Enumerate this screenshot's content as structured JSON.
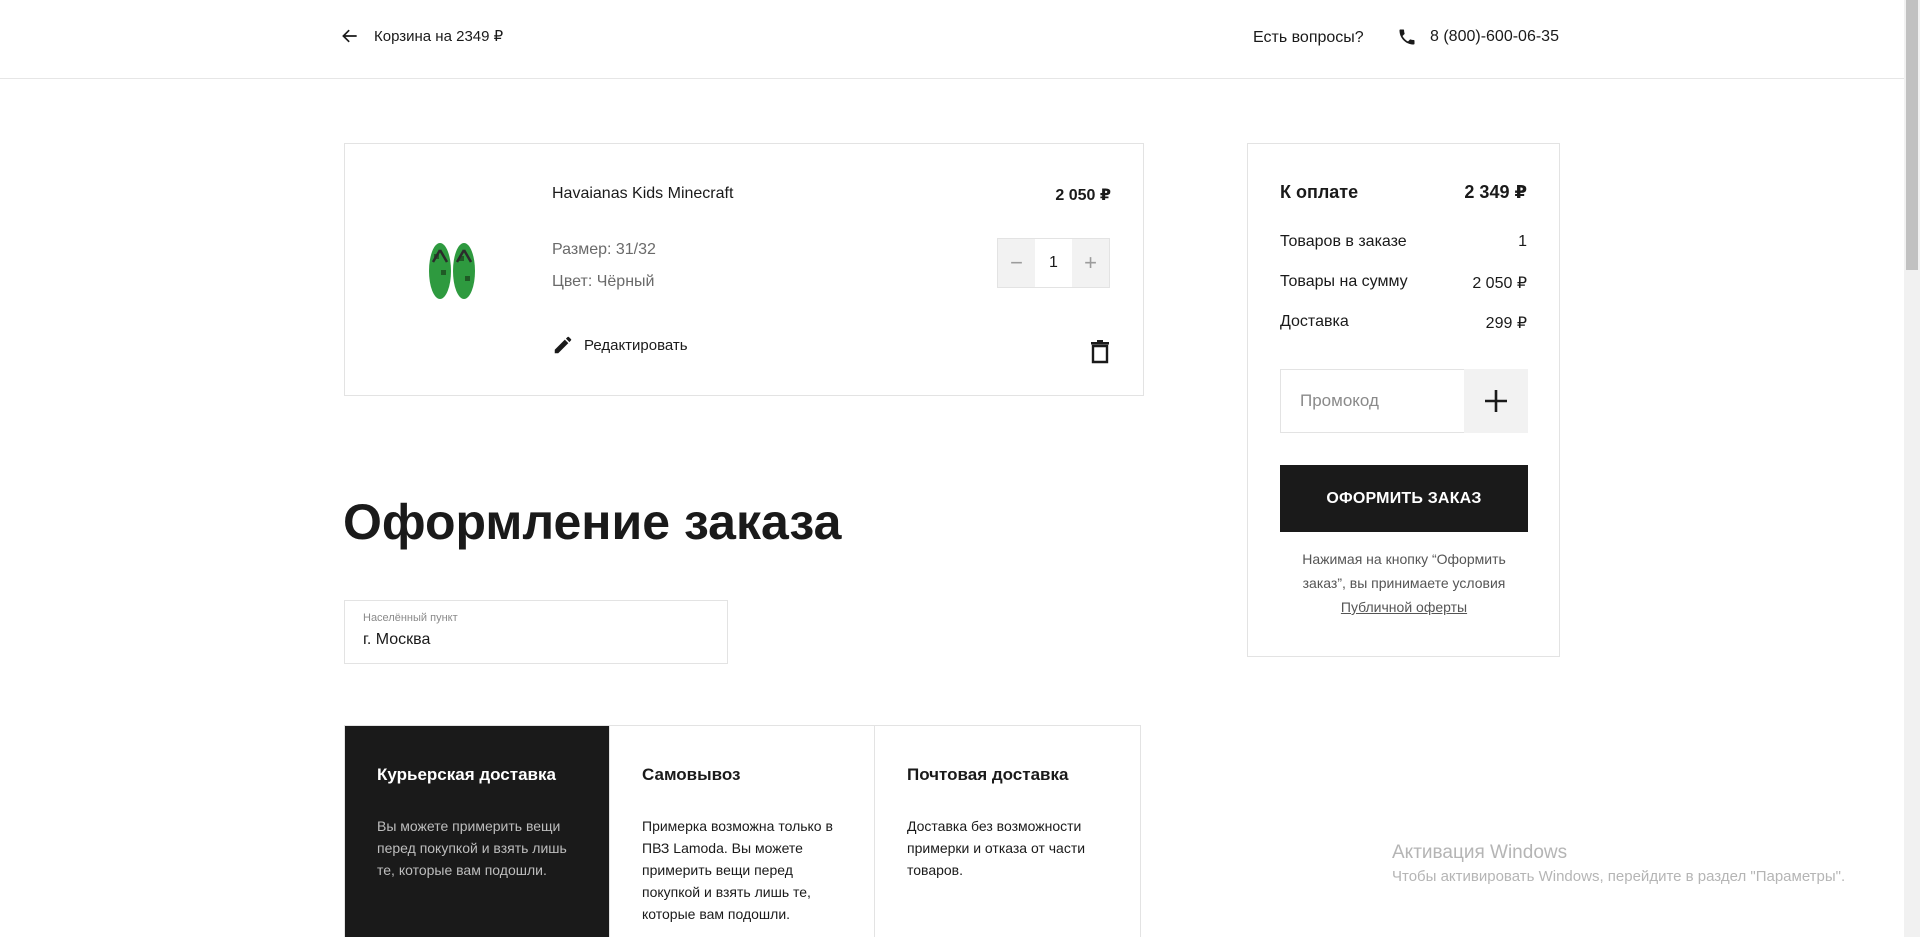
{
  "header": {
    "back_label": "Корзина на 2349 ₽",
    "help_label": "Есть вопросы?",
    "phone": "8 (800)-600-06-35"
  },
  "cart_item": {
    "name": "Havaianas Kids Minecraft",
    "price": "2 050 ₽",
    "size": "Размер: 31/32",
    "color": "Цвет: Чёрный",
    "edit_label": "Редактировать",
    "quantity": "1",
    "minus": "−",
    "plus": "+"
  },
  "summary": {
    "title": "К оплате",
    "total": "2 349 ₽",
    "rows": [
      {
        "label": "Товаров в заказе",
        "value": "1"
      },
      {
        "label": "Товары на сумму",
        "value": "2 050 ₽"
      },
      {
        "label": "Доставка",
        "value": "299 ₽"
      }
    ],
    "promo_placeholder": "Промокод",
    "order_button": "ОФОРМИТЬ ЗАКАЗ",
    "note": "Нажимая на кнопку “Оформить заказ”, вы принимаете условия",
    "offer_link": "Публичной оферты"
  },
  "checkout": {
    "title": "Оформление заказа",
    "city_label": "Населённый пункт",
    "city_value": "г. Москва",
    "tabs": [
      {
        "title": "Курьерская доставка",
        "desc": "Вы можете примерить вещи перед покупкой и взять лишь те, которые вам подошли."
      },
      {
        "title": "Самовывоз",
        "desc": "Примерка возможна только в ПВЗ Lamoda. Вы можете примерить вещи перед покупкой и взять лишь те, которые вам подошли."
      },
      {
        "title": "Почтовая доставка",
        "desc": "Доставка без возможности примерки и отказа от части товаров."
      }
    ]
  },
  "watermark": {
    "title": "Активация Windows",
    "subtitle": "Чтобы активировать Windows, перейдите в раздел \"Параметры\"."
  },
  "colors": {
    "dark": "#1a1a1a",
    "border": "#e3e3e3",
    "muted": "#6a6a6a",
    "product_green": "#2e9a3f"
  }
}
